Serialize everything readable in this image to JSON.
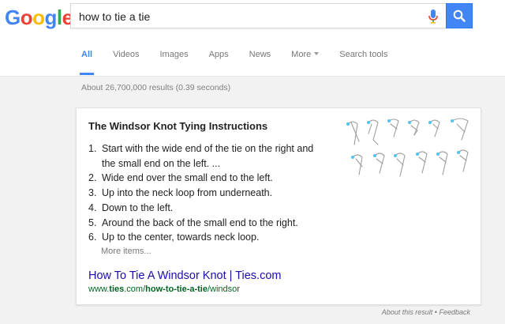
{
  "logo": {
    "letters": [
      "G",
      "o",
      "o",
      "g",
      "l",
      "e"
    ]
  },
  "search": {
    "value": "how to tie a tie"
  },
  "tabs": [
    {
      "label": "All",
      "active": true
    },
    {
      "label": "Videos",
      "active": false
    },
    {
      "label": "Images",
      "active": false
    },
    {
      "label": "Apps",
      "active": false
    },
    {
      "label": "News",
      "active": false
    },
    {
      "label": "More",
      "active": false
    },
    {
      "label": "Search tools",
      "active": false
    }
  ],
  "stats": "About 26,700,000 results (0.39 seconds)",
  "card": {
    "title": "The Windsor Knot Tying Instructions",
    "steps": [
      {
        "num": "1.",
        "line1": "Start with the wide end of the tie on the right and",
        "line2": "the small end on the left. ..."
      },
      {
        "num": "2.",
        "line1": "Wide end over the small end to the left."
      },
      {
        "num": "3.",
        "line1": "Up into the neck loop from underneath."
      },
      {
        "num": "4.",
        "line1": "Down to the left."
      },
      {
        "num": "5.",
        "line1": "Around the back of the small end to the right."
      },
      {
        "num": "6.",
        "line1": "Up to the center, towards neck loop."
      }
    ],
    "more_items": "More items...",
    "link": "How To Tie A Windsor Knot | Ties.com",
    "url_host": "www.",
    "url_bold1": "ties",
    "url_mid": ".com/",
    "url_bold2": "how-to-tie-a-tie",
    "url_tail": "/windsor"
  },
  "footer": {
    "about": "About this result",
    "sep": "•",
    "feedback": "Feedback"
  },
  "colors": {
    "accent": "#4285f4",
    "link": "#1a0dab",
    "url": "#006621"
  },
  "icons": [
    "microphone-icon",
    "search-icon",
    "tie-steps-illustration"
  ]
}
